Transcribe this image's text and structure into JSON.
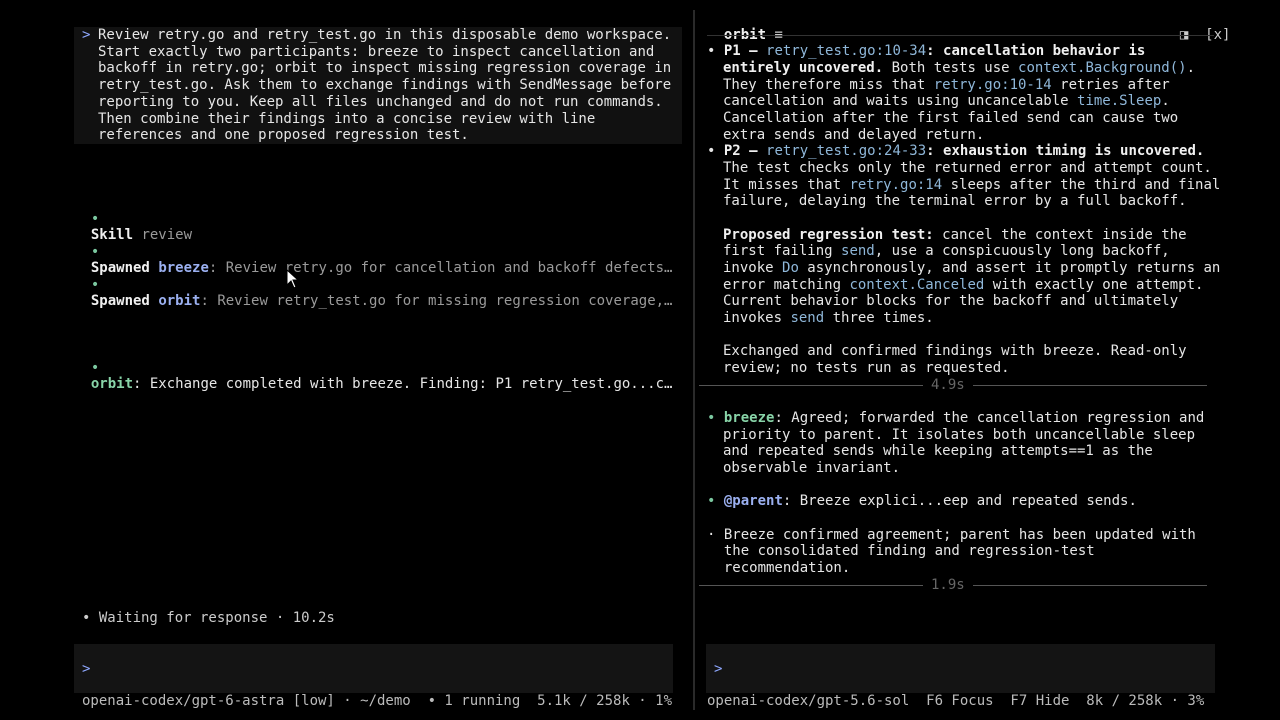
{
  "prompt": {
    "caret": ">",
    "lines": [
      "Review retry.go and retry_test.go in this disposable demo workspace.",
      "Start exactly two participants: breeze to inspect cancellation and",
      "backoff in retry.go; orbit to inspect missing regression coverage in",
      "retry_test.go. Ask them to exchange findings with SendMessage before",
      "reporting to you. Keep all files unchanged and do not run commands.",
      "Then combine their findings into a concise review with line",
      "references and one proposed regression test."
    ]
  },
  "events": [
    {
      "bullet": "•",
      "label": "Skill",
      "rest": " review"
    },
    {
      "bullet": "•",
      "label": "Spawned",
      "agent": "breeze",
      "rest": ": Review retry.go for cancellation and backoff defects…"
    },
    {
      "bullet": "•",
      "label": "Spawned",
      "agent": "orbit",
      "rest": ": Review retry_test.go for missing regression coverage,…"
    },
    {
      "bullet": "•",
      "agent": "orbit",
      "rest": ": Exchange completed with breeze. Finding: P1 retry_test.go...c…"
    }
  ],
  "waiting": "• Waiting for response · 10.2s",
  "left_input": {
    "caret": ">"
  },
  "left_status": "openai-codex/gpt-6-astra [low] · ~/demo  • 1 running  5.1k / 258k · 1%",
  "right_pane": {
    "title": "orbit",
    "menu_icon": "≡",
    "split_icon": "◨",
    "close_label": "[x]",
    "finding1": {
      "l1_pre": "• ",
      "l1_p": "P1 — ",
      "l1_ref": "retry_test.go:10-34",
      "l1_post": ": cancellation behavior is",
      "l2": "entirely uncovered.",
      "l2_rest": " Both tests use ",
      "l2_code": "context.Background()",
      "l2_end": ".",
      "l3_pre": "They therefore miss that ",
      "l3_ref": "retry.go:10-14",
      "l3_post": " retries after",
      "l4_pre": "cancellation and waits using uncancelable ",
      "l4_code": "time.Sleep",
      "l4_post": ".",
      "l5": "Cancellation after the first failed send can cause two",
      "l6": "extra sends and delayed return."
    },
    "finding2": {
      "l1_pre": "• ",
      "l1_p": "P2 — ",
      "l1_ref": "retry_test.go:24-33",
      "l1_post": ": exhaustion timing is uncovered.",
      "l2": "The test checks only the returned error and attempt count.",
      "l3_pre": "It misses that ",
      "l3_ref": "retry.go:14",
      "l3_post": " sleeps after the third and final",
      "l4": "failure, delaying the terminal error by a full backoff."
    },
    "proposal": {
      "l1_b": "Proposed regression test:",
      "l1_rest": " cancel the context inside the",
      "l2_pre": "first failing ",
      "l2_code": "send",
      "l2_post": ", use a conspicuously long backoff,",
      "l3_pre": "invoke ",
      "l3_code": "Do",
      "l3_post": " asynchronously, and assert it promptly returns an",
      "l4_pre": "error matching ",
      "l4_code": "context.Canceled",
      "l4_post": " with exactly one attempt.",
      "l5": "Current behavior blocks for the backoff and ultimately",
      "l6_pre": "invokes ",
      "l6_code": "send",
      "l6_post": " three times."
    },
    "exchanged": [
      "Exchanged and confirmed findings with breeze. Read-only",
      "review; no tests run as requested."
    ],
    "sep1": "4.9s",
    "breeze_msg": {
      "agent": "breeze",
      "lines": [
        ": Agreed; forwarded the cancellation regression and",
        "priority to parent. It isolates both uncancellable sleep",
        "and repeated sends while keeping attempts==1 as the",
        "observable invariant."
      ]
    },
    "parent_msg": {
      "agent": "@parent",
      "rest": ": Breeze explici...eep and repeated sends."
    },
    "confirm": [
      "· Breeze confirmed agreement; parent has been updated with",
      "  the consolidated finding and regression-test",
      "  recommendation."
    ],
    "sep2": "1.9s"
  },
  "right_input": {
    "caret": ">"
  },
  "right_status": "openai-codex/gpt-5.6-sol  F6 Focus  F7 Hide  8k / 258k · 3%"
}
